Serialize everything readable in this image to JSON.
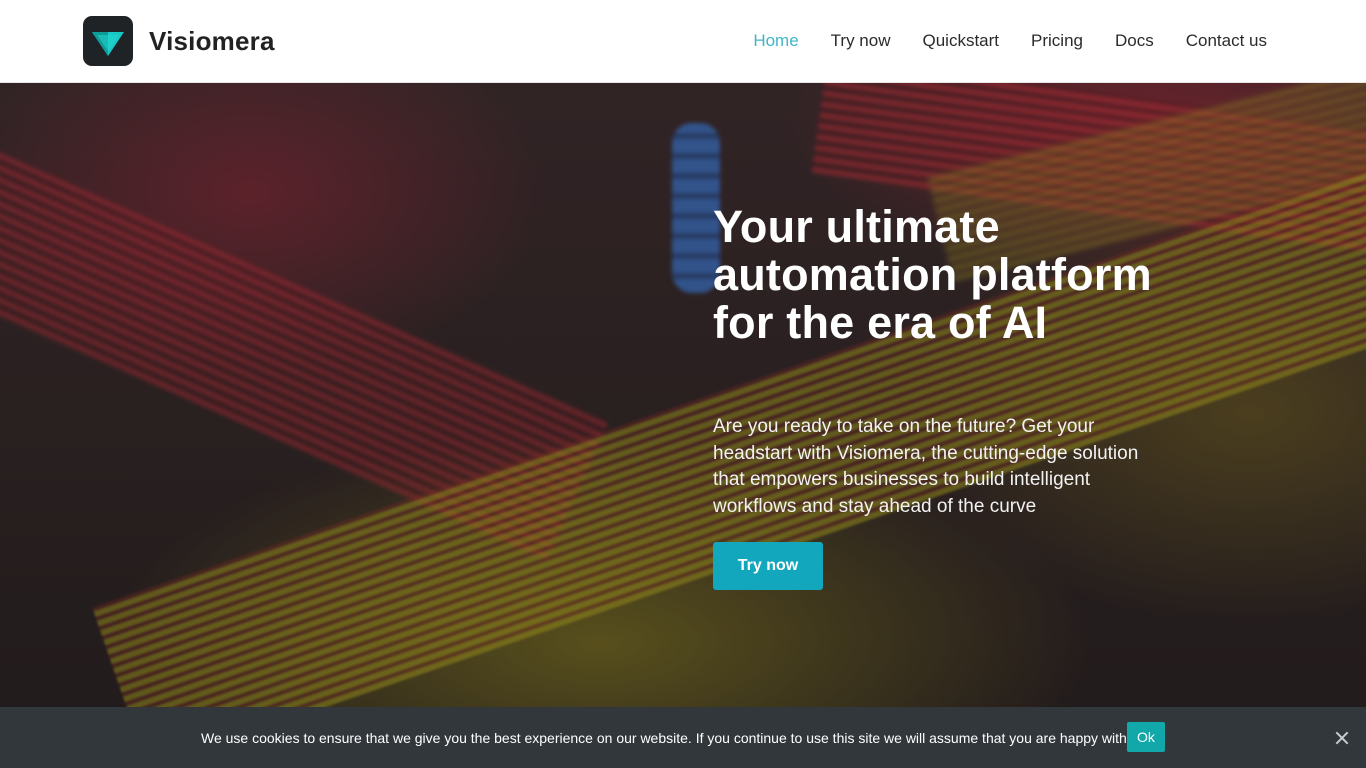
{
  "brand": {
    "name": "Visiomera",
    "logo_icon": "teal-triangle-logo-icon"
  },
  "nav": {
    "items": [
      {
        "label": "Home",
        "active": true
      },
      {
        "label": "Try now",
        "active": false
      },
      {
        "label": "Quickstart",
        "active": false
      },
      {
        "label": "Pricing",
        "active": false
      },
      {
        "label": "Docs",
        "active": false
      },
      {
        "label": "Contact us",
        "active": false
      }
    ]
  },
  "hero": {
    "headline": "Your ultimate automation platform for the era of AI",
    "subtext": "Are you ready to take on the future? Get your headstart with Visiomera, the cutting-edge solution that empowers businesses to build intelligent workflows and stay ahead of the curve",
    "cta_label": "Try now"
  },
  "cookie": {
    "message": "We use cookies to ensure that we give you the best experience on our website. If you continue to use this site we will assume that you are happy with it.",
    "ok_label": "Ok",
    "close_icon": "close-icon"
  },
  "colors": {
    "accent": "#12a7bd",
    "nav_active": "#3fb7c9",
    "cookie_bar": "#32373c",
    "cookie_ok": "#12a7a8"
  }
}
